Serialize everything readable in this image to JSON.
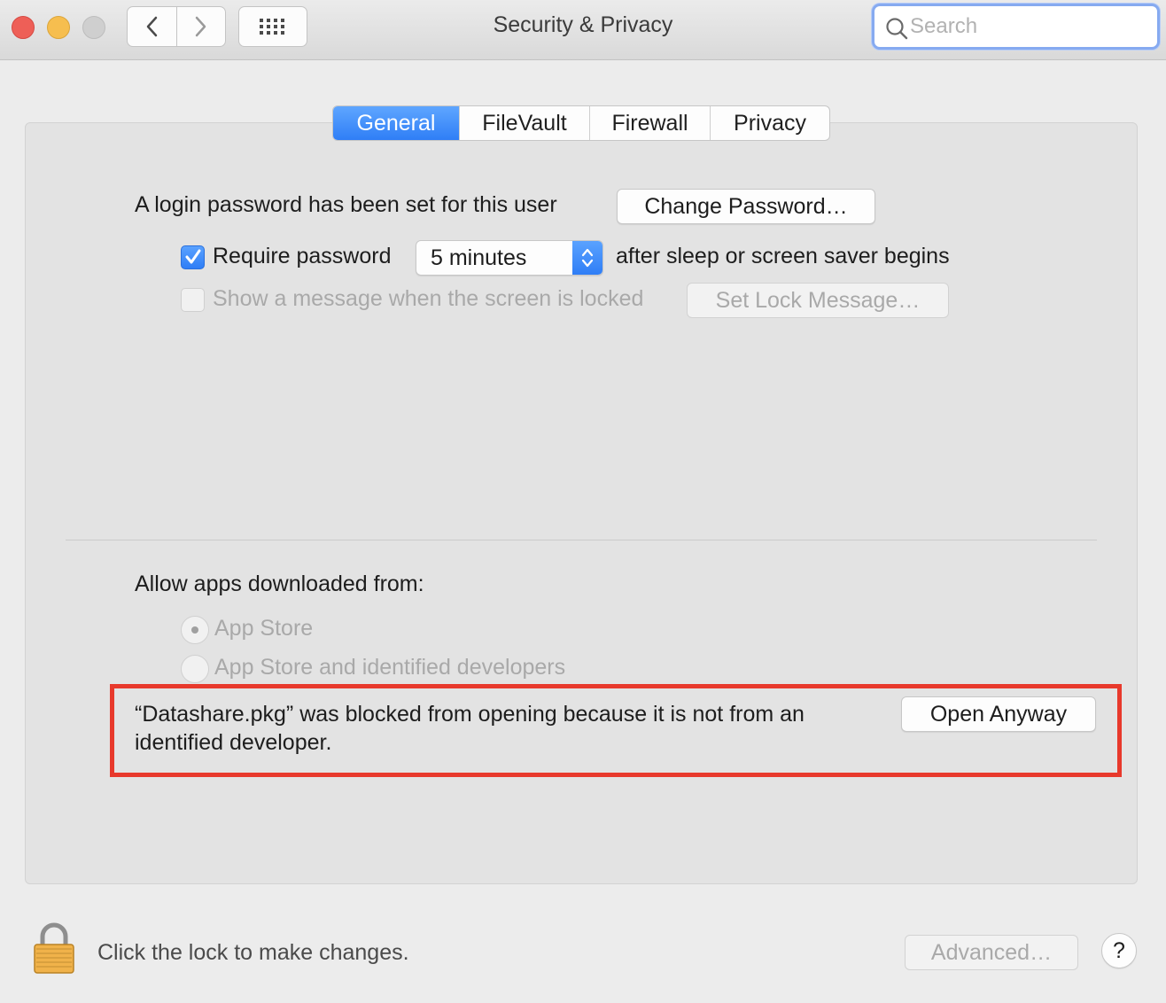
{
  "window": {
    "title": "Security & Privacy"
  },
  "toolbar": {
    "back_icon": "chevron-left-icon",
    "forward_icon": "chevron-right-icon",
    "show_all_icon": "grid-icon",
    "search_placeholder": "Search"
  },
  "tabs": [
    {
      "label": "General",
      "selected": true
    },
    {
      "label": "FileVault",
      "selected": false
    },
    {
      "label": "Firewall",
      "selected": false
    },
    {
      "label": "Privacy",
      "selected": false
    }
  ],
  "general": {
    "login_password_text": "A login password has been set for this user",
    "change_password_label": "Change Password…",
    "require_password": {
      "label": "Require password",
      "checked": true
    },
    "require_password_delay": "5 minutes",
    "after_sleep_text": "after sleep or screen saver begins",
    "show_message": {
      "label": "Show a message when the screen is locked",
      "checked": false
    },
    "set_lock_message_label": "Set Lock Message…"
  },
  "allow_apps": {
    "heading": "Allow apps downloaded from:",
    "options": [
      {
        "label": "App Store",
        "selected": true
      },
      {
        "label": "App Store and identified developers",
        "selected": false
      }
    ],
    "blocked_message": "“Datashare.pkg” was blocked from opening because it is not from an identified developer.",
    "open_anyway_label": "Open Anyway"
  },
  "footer": {
    "lock_text": "Click the lock to make changes.",
    "advanced_label": "Advanced…",
    "help_label": "?"
  },
  "colors": {
    "accent_blue": "#2f7ef6",
    "highlight_red": "#e8392c"
  }
}
